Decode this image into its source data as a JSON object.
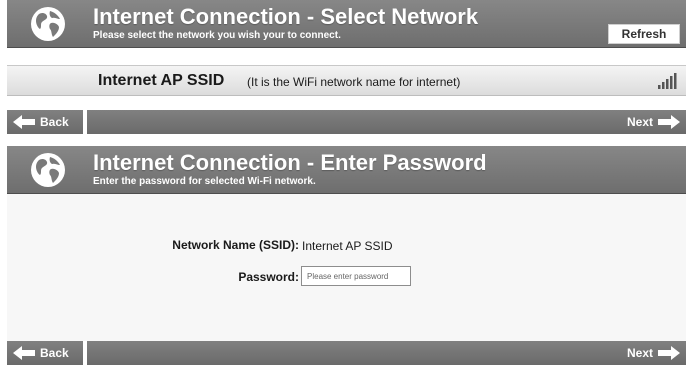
{
  "select_network": {
    "title": "Internet Connection - Select Network",
    "subtitle": "Please select the network you wish your to connect.",
    "refresh_label": "Refresh",
    "network": {
      "ssid": "Internet AP SSID",
      "note": "(It is the WiFi network name for internet)",
      "signal_icon": "signal-strength-icon"
    },
    "back_label": "Back",
    "next_label": "Next"
  },
  "enter_password": {
    "title": "Internet Connection - Enter Password",
    "subtitle": "Enter the password for selected Wi-Fi network.",
    "ssid_label": "Network Name (SSID):",
    "ssid_value": "Internet AP SSID",
    "password_label": "Password:",
    "password_placeholder": "Please enter password",
    "password_value": "",
    "back_label": "Back",
    "next_label": "Next"
  },
  "icons": {
    "globe": "globe-icon",
    "back": "arrow-left-icon",
    "next": "arrow-right-icon"
  },
  "colors": {
    "header": "#7a7a7a",
    "footer": "#757575",
    "row": "#e6e6e6",
    "text_light": "#ffffff"
  }
}
